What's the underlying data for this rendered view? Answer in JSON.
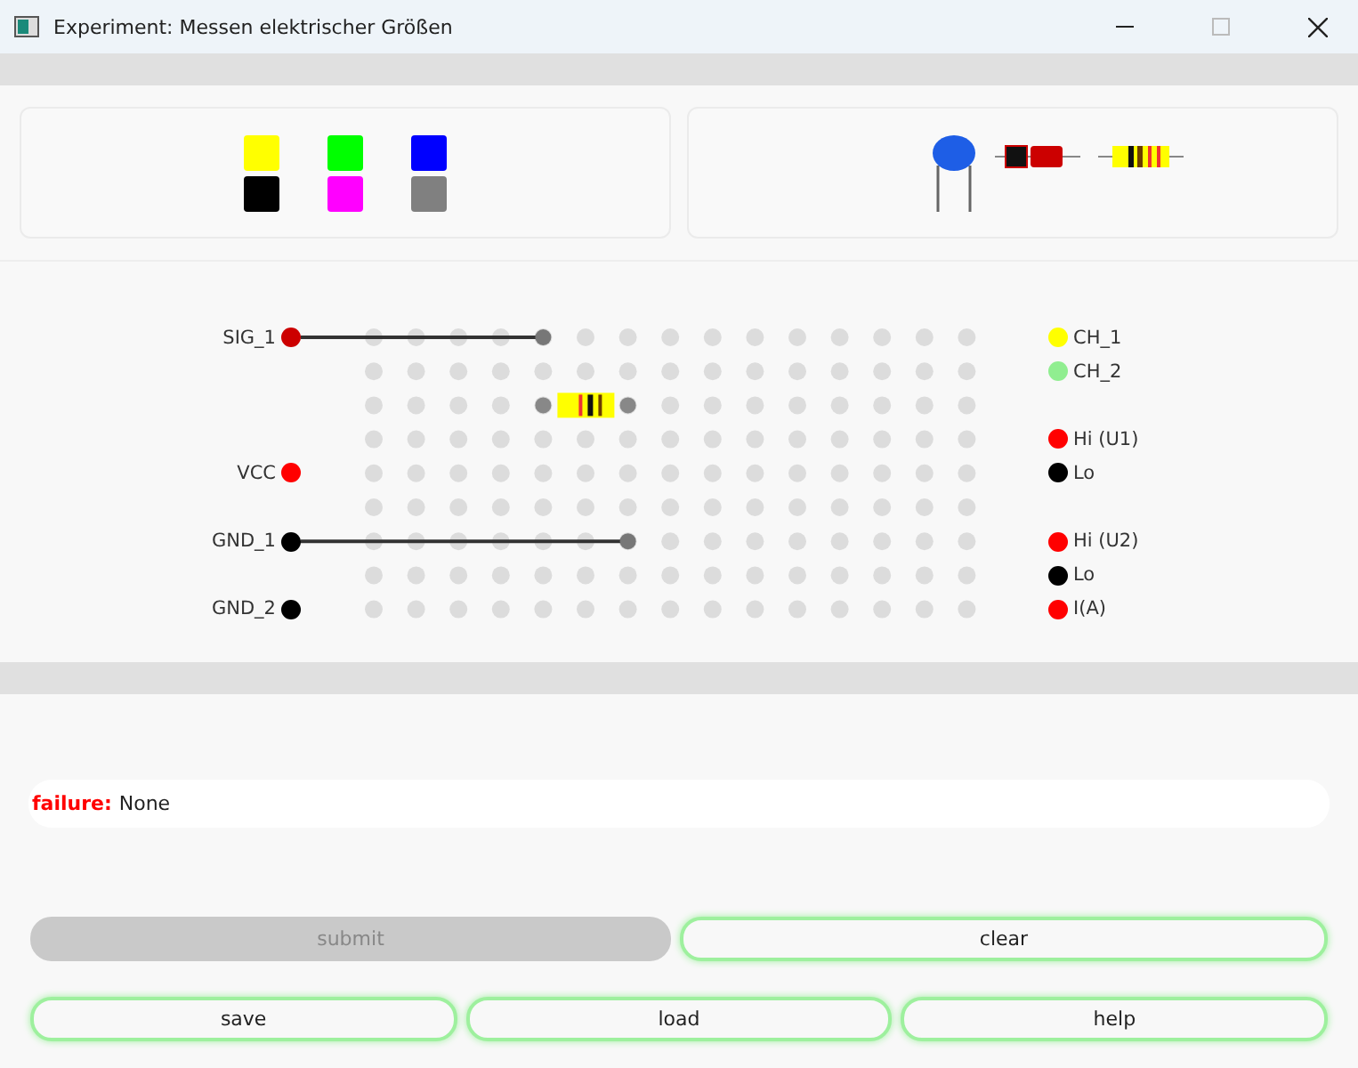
{
  "window": {
    "title": "Experiment: Messen elektrischer Größen"
  },
  "palette": [
    {
      "color": "#ffff00"
    },
    {
      "color": "#00ff00"
    },
    {
      "color": "#0000ff"
    },
    {
      "color": "#000000"
    },
    {
      "color": "#ff00ff"
    },
    {
      "color": "#808080"
    }
  ],
  "left_terminals": [
    {
      "label": "SIG_1",
      "color": "#cc0000"
    },
    {
      "label": "VCC",
      "color": "#ff0000"
    },
    {
      "label": "GND_1",
      "color": "#000000"
    },
    {
      "label": "GND_2",
      "color": "#000000"
    }
  ],
  "right_terminals": [
    {
      "label": "CH_1",
      "color": "#ffff00"
    },
    {
      "label": "CH_2",
      "color": "#90ee90"
    },
    {
      "label": "Hi (U1)",
      "color": "#ff0000"
    },
    {
      "label": "Lo",
      "color": "#000000"
    },
    {
      "label": "Hi (U2)",
      "color": "#ff0000"
    },
    {
      "label": "Lo",
      "color": "#000000"
    },
    {
      "label": "I(A)",
      "color": "#ff0000"
    }
  ],
  "status": {
    "label": "failure:",
    "value": "None"
  },
  "buttons": [
    {
      "label": "submit",
      "disabled": true
    },
    {
      "label": "clear",
      "disabled": false
    }
  ],
  "file_buttons": [
    {
      "label": "save",
      "disabled": false
    },
    {
      "label": "load",
      "disabled": false
    },
    {
      "label": "help",
      "disabled": false
    }
  ]
}
